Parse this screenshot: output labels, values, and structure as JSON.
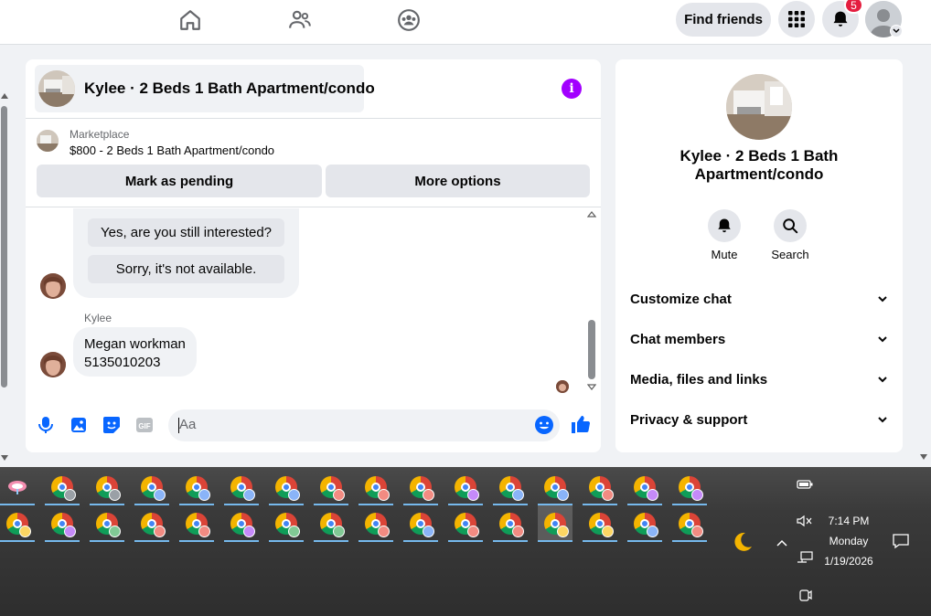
{
  "topbar": {
    "find_friends_label": "Find friends",
    "notification_count": "5"
  },
  "chat": {
    "title": "Kylee · 2 Beds 1 Bath Apartment/condo",
    "marketplace_label": "Marketplace",
    "listing": "$800 - 2 Beds 1 Bath Apartment/condo",
    "mark_pending_label": "Mark as pending",
    "more_options_label": "More options",
    "quick_replies": [
      "Yes, are you still interested?",
      "Sorry, it's not available."
    ],
    "sender_name": "Kylee",
    "message_lines": [
      "Megan workman",
      "5135010203"
    ],
    "composer_placeholder": "Aa"
  },
  "side": {
    "title_line1": "Kylee · 2 Beds 1 Bath",
    "title_line2": "Apartment/condo",
    "mute_label": "Mute",
    "search_label": "Search",
    "rows": [
      "Customize chat",
      "Chat members",
      "Media, files and links",
      "Privacy & support"
    ]
  },
  "taskbar": {
    "time": "7:14 PM",
    "day": "Monday",
    "date": "1/19/2026",
    "profile_colors_row1": [
      "#ffffff",
      "#9aa0a6",
      "#9aa0a6",
      "#8ab4f8",
      "#8ab4f8",
      "#8ab4f8",
      "#8ab4f8",
      "#f28b82",
      "#f28b82",
      "#f28b82",
      "#c58af9",
      "#8ab4f8",
      "#8ab4f8",
      "#f28b82",
      "#c58af9",
      "#c58af9"
    ],
    "profile_colors_row2": [
      "#fdd663",
      "#c58af9",
      "#81c995",
      "#f28b82",
      "#f28b82",
      "#c58af9",
      "#81c995",
      "#81c995",
      "#f28b82",
      "#8ab4f8",
      "#f28b82",
      "#f28b82",
      "#fdd663",
      "#fdd663",
      "#8ab4f8",
      "#f28b82"
    ]
  },
  "colors": {
    "messenger_blue": "#0866ff",
    "info_purple": "#a200ff",
    "badge_red": "#e41e3f"
  }
}
